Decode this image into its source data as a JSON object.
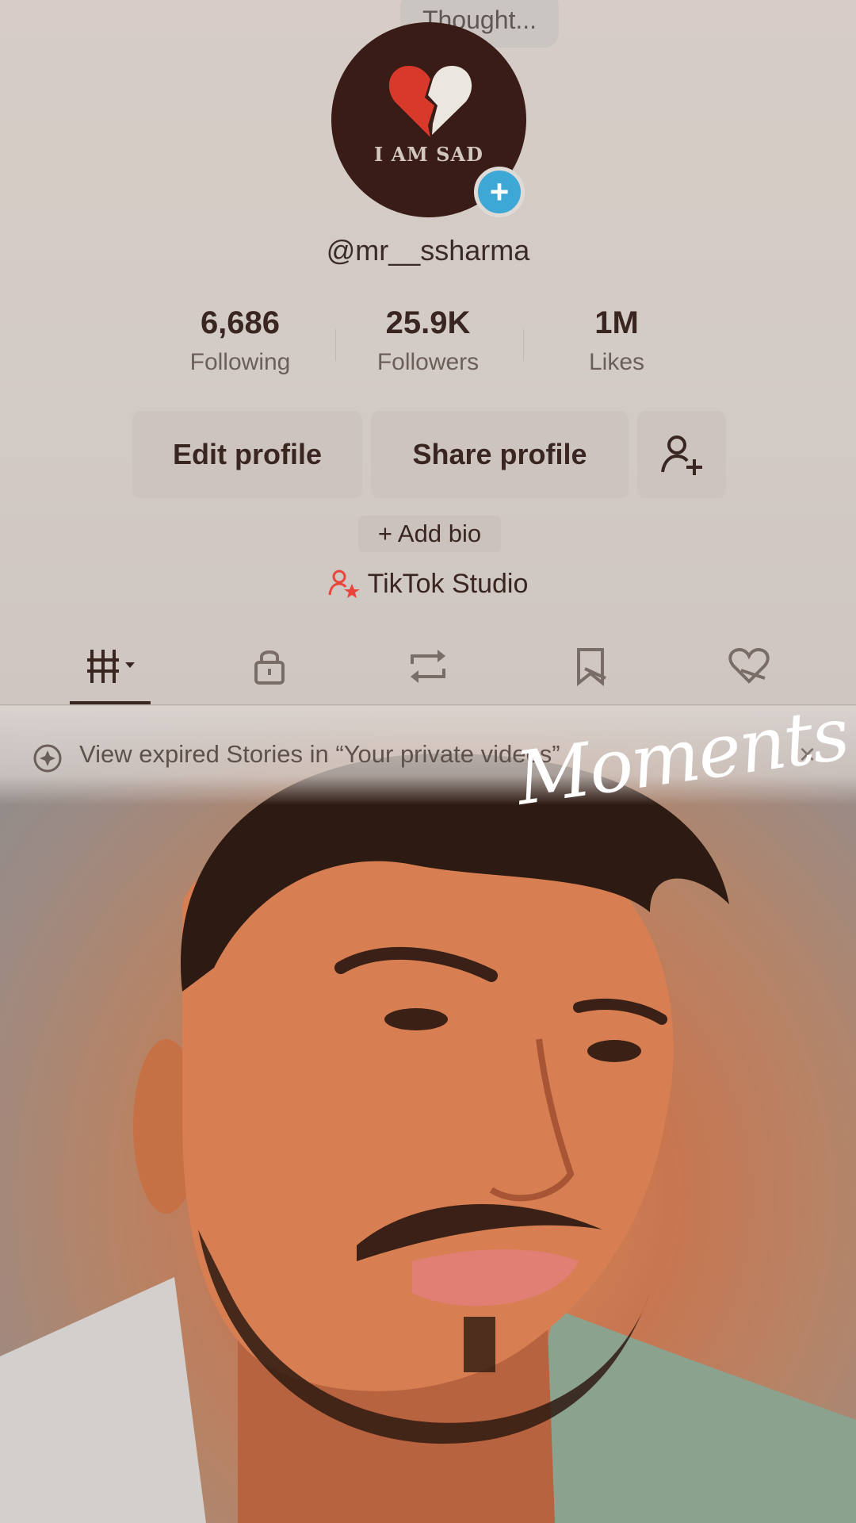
{
  "thought_bubble": {
    "text": "Thought..."
  },
  "avatar": {
    "text": "I AM SAD",
    "add_label": "+"
  },
  "profile": {
    "username": "@mr__ssharma"
  },
  "stats": [
    {
      "value": "6,686",
      "label": "Following"
    },
    {
      "value": "25.9K",
      "label": "Followers"
    },
    {
      "value": "1M",
      "label": "Likes"
    }
  ],
  "buttons": {
    "edit": "Edit profile",
    "share": "Share profile"
  },
  "bio": {
    "add_label": "+ Add bio"
  },
  "studio": {
    "label": "TikTok Studio"
  },
  "tabs": [
    {
      "icon": "grid-icon"
    },
    {
      "icon": "lock-icon"
    },
    {
      "icon": "repost-icon"
    },
    {
      "icon": "bookmark-icon"
    },
    {
      "icon": "liked-heart-icon"
    }
  ],
  "banner": {
    "text": "View expired Stories in “Your private videos”",
    "close": "×"
  },
  "overlay": {
    "moments_text": "Moments"
  },
  "colors": {
    "accent_blue": "#3da7d6",
    "studio_red": "#e8453c",
    "text_dark": "#3a2620"
  }
}
